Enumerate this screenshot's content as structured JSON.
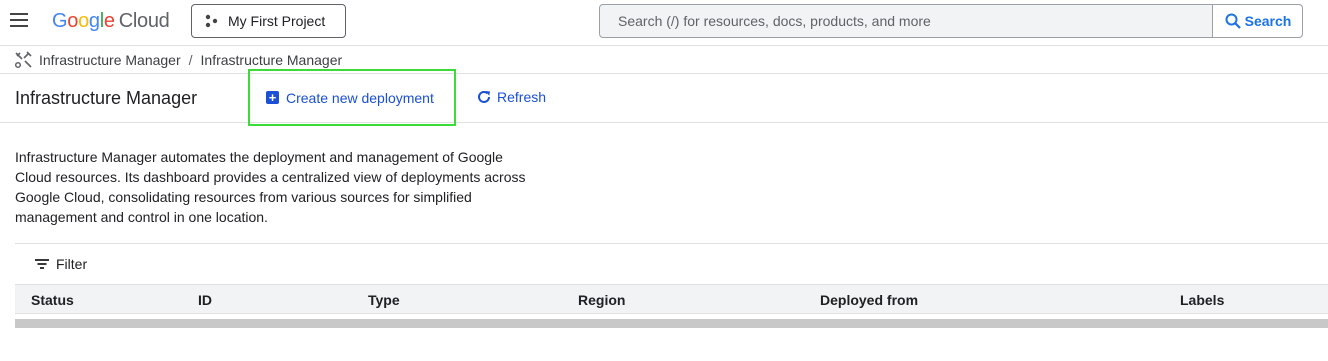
{
  "topbar": {
    "logo": {
      "g1": "G",
      "g2": "o",
      "g3": "o",
      "g4": "g",
      "g5": "l",
      "g6": "e",
      "cloud": "Cloud"
    },
    "project_label": "My First Project",
    "search_placeholder": "Search (/) for resources, docs, products, and more",
    "search_button": "Search"
  },
  "breadcrumb": {
    "items": [
      "Infrastructure Manager",
      "Infrastructure Manager"
    ],
    "separator": "/"
  },
  "header": {
    "title": "Infrastructure Manager",
    "create_label": "Create new deployment",
    "refresh_label": "Refresh"
  },
  "description": "Infrastructure Manager automates the deployment and management of Google Cloud resources. Its dashboard provides a centralized view of deployments across Google Cloud, consolidating resources from various sources for simplified management and control in one location.",
  "filter_label": "Filter",
  "table": {
    "columns": [
      "Status",
      "ID",
      "Type",
      "Region",
      "Deployed from",
      "Labels"
    ]
  },
  "colors": {
    "accent": "#1a4fd6",
    "highlight": "#3ddb37",
    "search_accent": "#1a73e8"
  },
  "icons": [
    "menu-icon",
    "project-icon",
    "search-icon",
    "infra-manager-icon",
    "plus-icon",
    "refresh-icon",
    "filter-icon"
  ]
}
